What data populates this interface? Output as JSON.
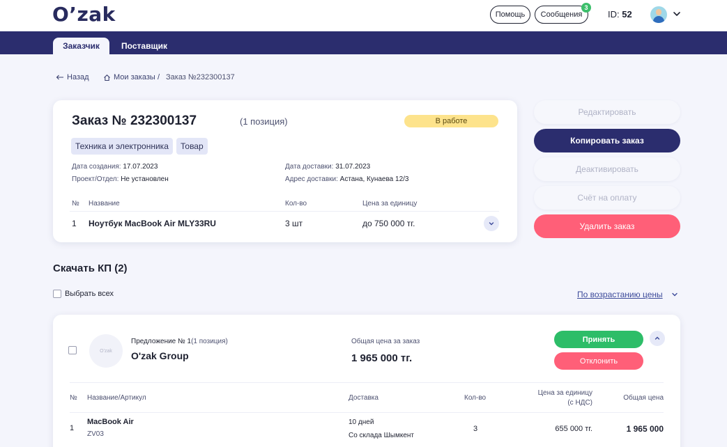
{
  "header": {
    "logo": "O’zak",
    "help_label": "Помощь",
    "messages_label": "Сообщения",
    "messages_count": "3",
    "user_id_label": "ID:",
    "user_id_value": "52"
  },
  "tabs": [
    {
      "label": "Заказчик",
      "active": true
    },
    {
      "label": "Поставщик",
      "active": false
    }
  ],
  "breadcrumb": {
    "back": "Назад",
    "my_orders": "Мои заказы",
    "separator": "/",
    "current": "Заказ №232300137"
  },
  "order": {
    "title": "Заказ № 232300137",
    "positions": "(1 позиция)",
    "status": "В работе",
    "tags": [
      "Техника и электронника",
      "Товар"
    ],
    "created_label": "Дата создания:",
    "created_value": "17.07.2023",
    "project_label": "Проект/Отдел:",
    "project_value": "Не установлен",
    "delivery_date_label": "Дата доставки:",
    "delivery_date_value": "31.07.2023",
    "delivery_address_label": "Адрес доставки:",
    "delivery_address_value": "Астана, Кунаева 12/3",
    "table_headers": [
      "№",
      "Название",
      "Кол-во",
      "Цена за единицу"
    ],
    "items": [
      {
        "num": "1",
        "name": "Ноутбук MacBook Air MLY33RU",
        "qty": "3 шт",
        "price": "до 750 000 тг."
      }
    ]
  },
  "actions": {
    "edit": "Редактировать",
    "copy": "Копировать заказ",
    "deactivate": "Деактивировать",
    "invoice": "Счёт на оплату",
    "delete": "Удалить заказ"
  },
  "kp": {
    "title": "Скачать КП (2)",
    "select_all": "Выбрать всех",
    "sort": "По возрастанию цены"
  },
  "offer": {
    "logo_text": "O'zak",
    "number": "Предложение № 1",
    "positions": "(1 позиция)",
    "company": "O'zak Group",
    "total_label": "Общая цена за заказ",
    "total_value": "1 965 000 тг.",
    "accept": "Принять",
    "reject": "Отклонить",
    "headers": {
      "num": "№",
      "name": "Название/Артикул",
      "delivery": "Доставка",
      "qty": "Кол-во",
      "unit_price_line1": "Цена за единицу",
      "unit_price_line2": "(с НДС)",
      "total": "Общая цена"
    },
    "items": [
      {
        "num": "1",
        "name": "MacBook Air",
        "sku": "ZV03",
        "delivery_days": "10 дней",
        "delivery_from": "Со склада Шымкент",
        "qty": "3",
        "unit_price": "655 000 тг.",
        "total": "1 965 000"
      }
    ]
  },
  "colors": {
    "brand": "#2b2d6e",
    "accept": "#2dbd68",
    "danger": "#ff5f78",
    "status": "#fde38c"
  }
}
